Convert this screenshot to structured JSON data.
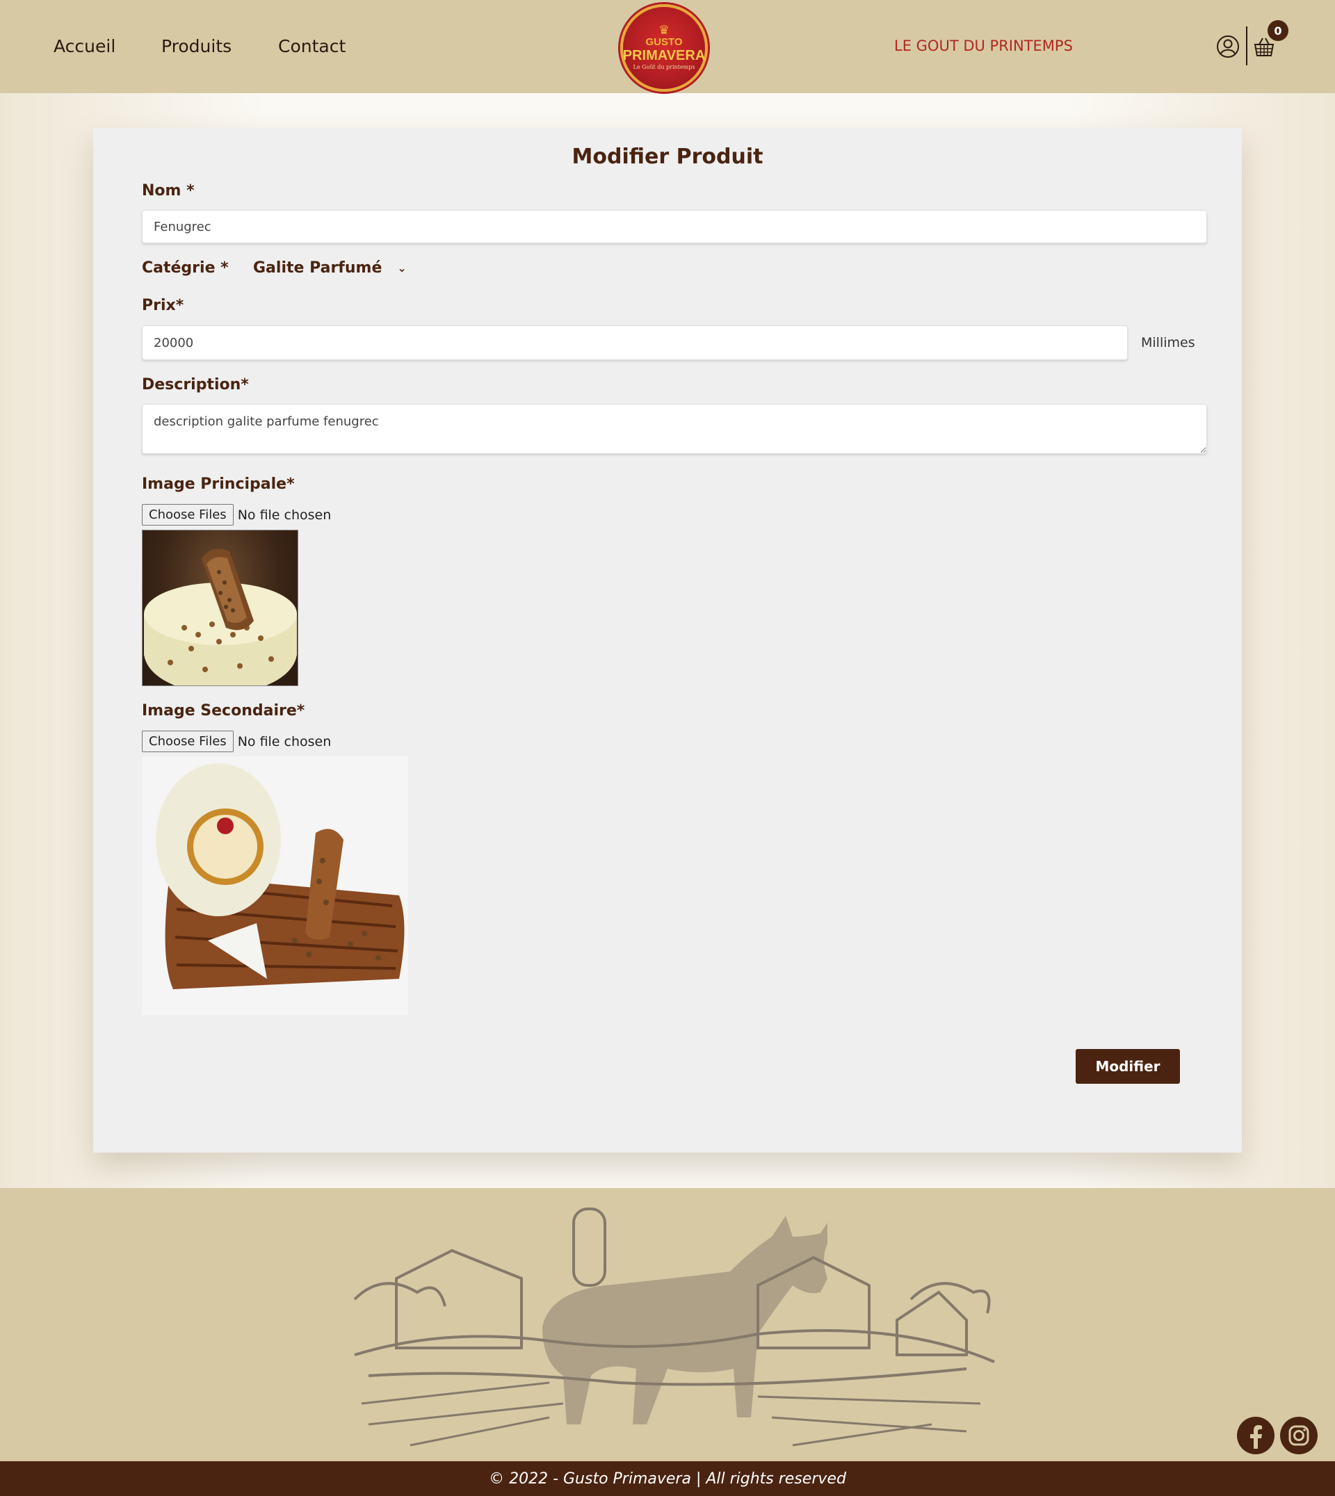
{
  "nav": {
    "items": [
      {
        "label": "Accueil"
      },
      {
        "label": "Produits"
      },
      {
        "label": "Contact"
      }
    ],
    "tagline": "LE GOUT DU PRINTEMPS",
    "cart_count": "0"
  },
  "logo": {
    "line1": "GUSTO",
    "line2": "PRIMAVERA",
    "line3": "Le Goût du printemps"
  },
  "form": {
    "title": "Modifier Produit",
    "nom_label": "Nom *",
    "nom_value": "Fenugrec",
    "categorie_label": "Catégrie *",
    "categorie_value": "Galite Parfumé",
    "prix_label": "Prix*",
    "prix_value": "20000",
    "prix_unit": "Millimes",
    "description_label": "Description*",
    "description_value": "description galite parfume fenugrec",
    "image_principale_label": "Image Principale*",
    "image_secondaire_label": "Image Secondaire*",
    "file_button": "Choose Files",
    "file_status": "No file chosen",
    "submit_label": "Modifier"
  },
  "footer": {
    "copyright": "© 2022 - Gusto Primavera | All rights reserved",
    "social": [
      "facebook-icon",
      "instagram-icon"
    ]
  },
  "colors": {
    "header_bg": "#d7c9a4",
    "brand_brown": "#4a2411",
    "tagline_red": "#b0281f",
    "card_bg": "#efefef"
  }
}
